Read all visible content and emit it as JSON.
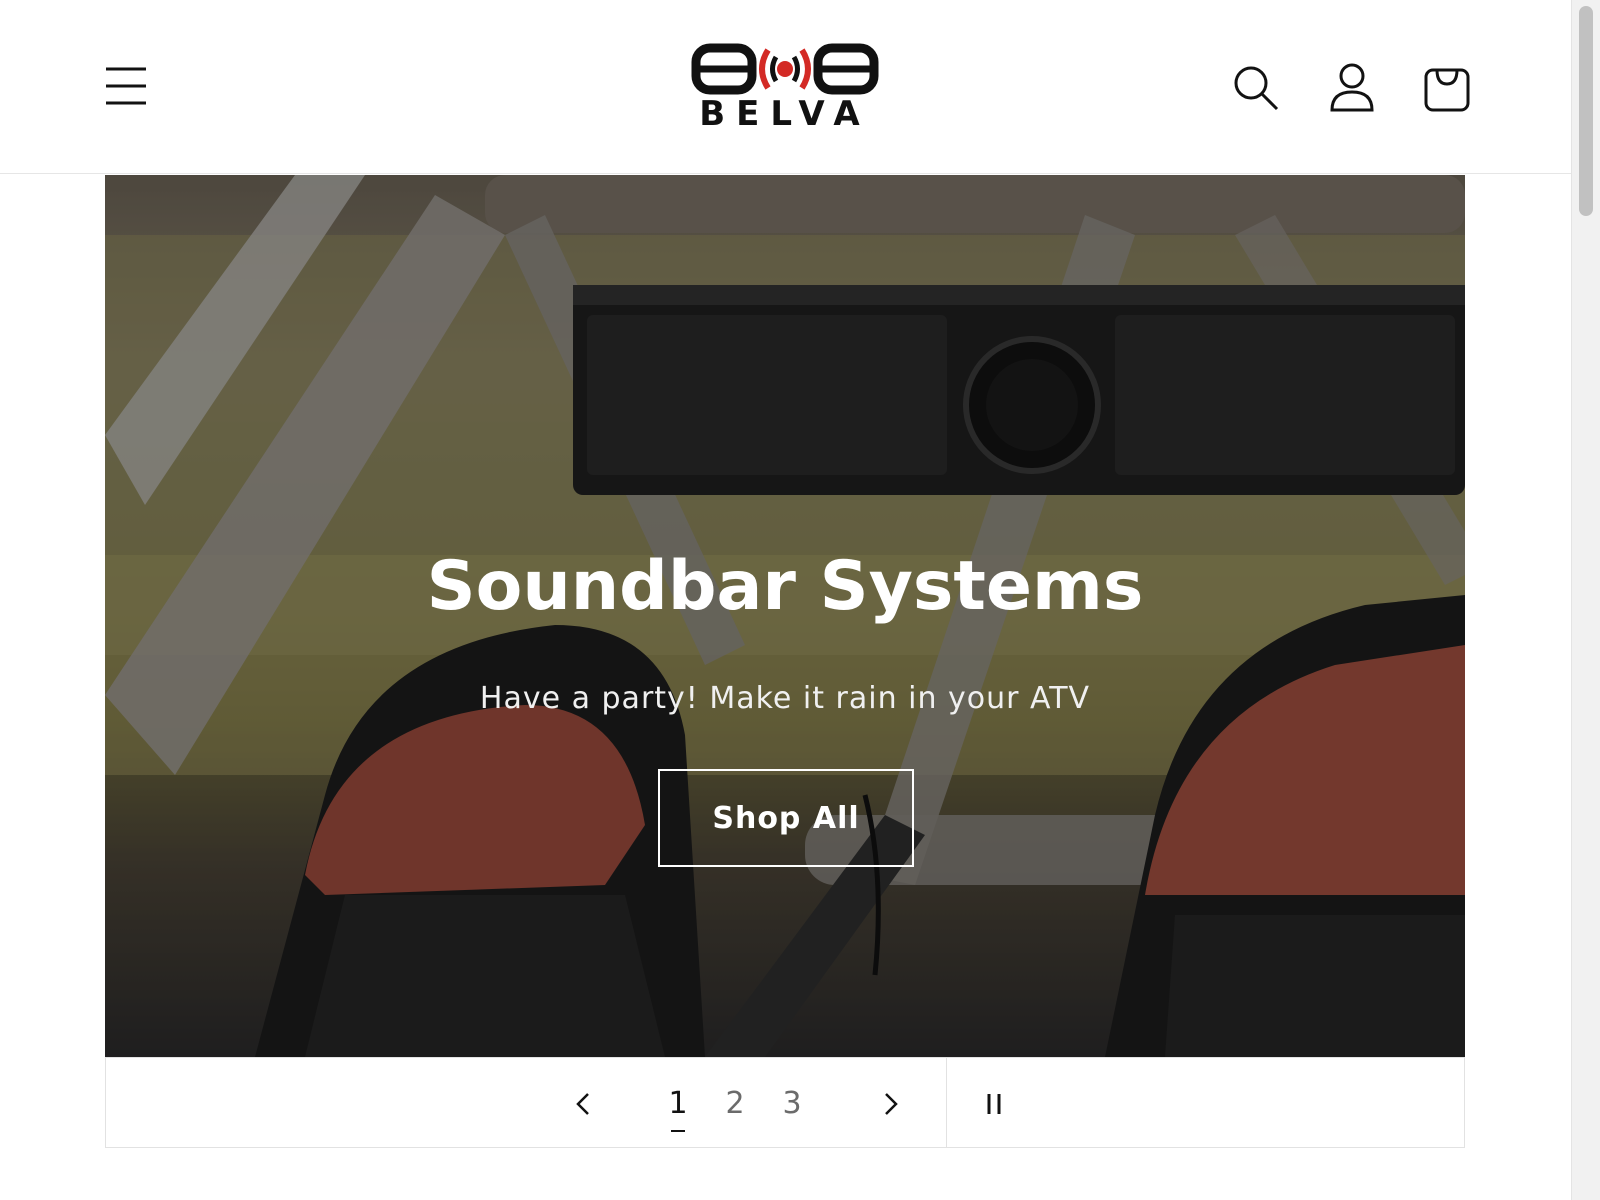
{
  "header": {
    "logo_text": "BELVA",
    "icons": {
      "menu": "hamburger-menu-icon",
      "search": "search-icon",
      "account": "account-icon",
      "cart": "cart-icon"
    }
  },
  "hero": {
    "title": "Soundbar Systems",
    "subtitle": "Have a party! Make it rain in your ATV",
    "button_label": "Shop All"
  },
  "slideshow": {
    "slides": [
      "1",
      "2",
      "3"
    ],
    "active_slide": 1,
    "icons": {
      "previous": "chevron-left-icon",
      "next": "chevron-right-icon",
      "pause": "pause-icon"
    }
  },
  "colors": {
    "brand_red": "#d32a25",
    "text": "#121212",
    "muted": "#6b6b6b"
  }
}
